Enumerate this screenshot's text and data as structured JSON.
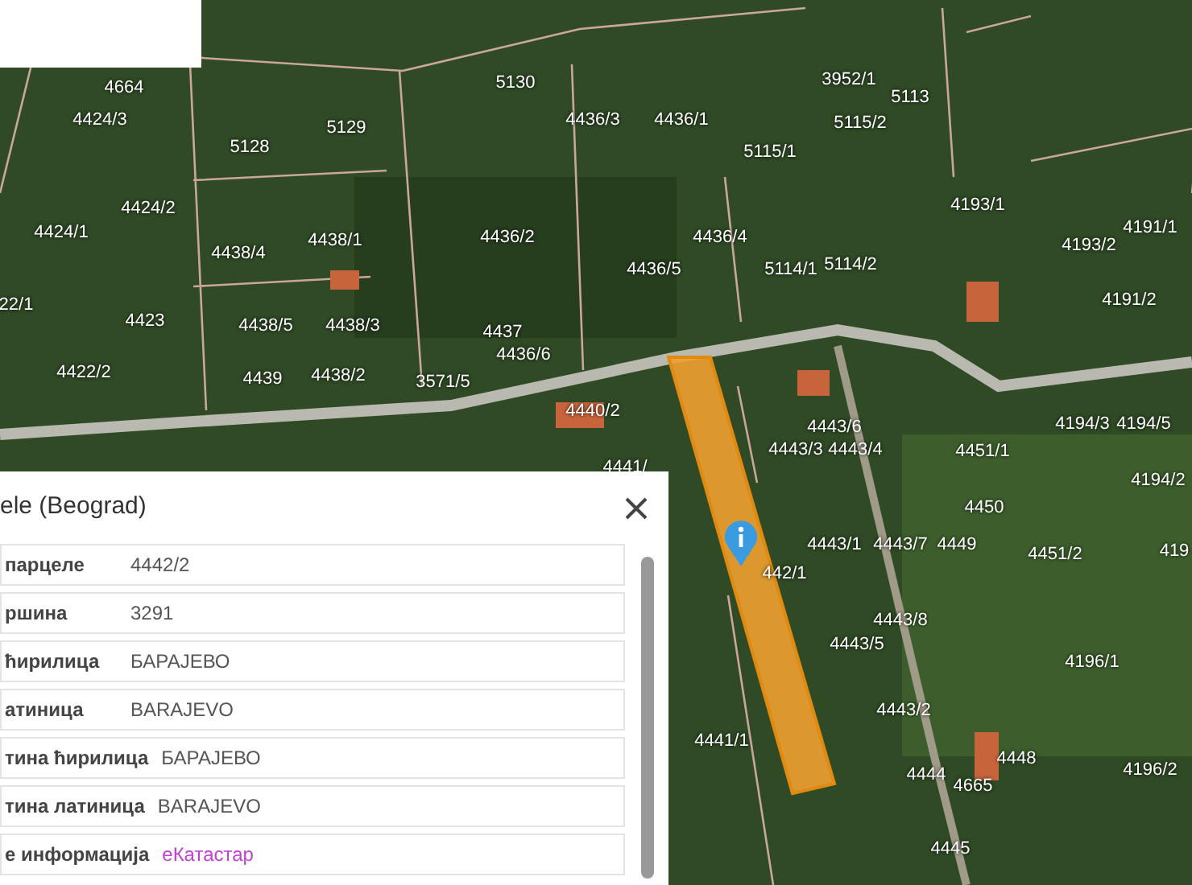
{
  "map": {
    "parcel_labels": [
      "4664",
      "4424/3",
      "5130",
      "5129",
      "5128",
      "4436/3",
      "4436/1",
      "3952/1",
      "5113",
      "5115/2",
      "5115/1",
      "4424/2",
      "4424/1",
      "4438/1",
      "4438/4",
      "4436/2",
      "4436/4",
      "4193/1",
      "4191/1",
      "4193/2",
      "4436/5",
      "5114/1",
      "5114/2",
      "22/1",
      "4423",
      "4438/5",
      "4438/3",
      "4437",
      "4191/2",
      "4436/6",
      "4422/2",
      "4439",
      "4438/2",
      "3571/5",
      "4440/2",
      "4443/6",
      "4194/3",
      "4194/5",
      "4443/3",
      "4443/4",
      "4451/1",
      "4441/",
      "4194/2",
      "4450",
      "4443/1",
      "4443/7",
      "4449",
      "4451/2",
      "442/1",
      "419",
      "4443/8",
      "4443/5",
      "4196/1",
      "4443/2",
      "4441/1",
      "4196/2",
      "4448",
      "4444",
      "4665",
      "4445"
    ]
  },
  "popup": {
    "title": "ele (Beograd)",
    "rows": [
      {
        "kind": "text",
        "label": "парцеле",
        "value": "4442/2"
      },
      {
        "kind": "text",
        "label": "ршина",
        "value": "3291"
      },
      {
        "kind": "text",
        "label": "ћирилица",
        "value": "БАРАЈЕВО"
      },
      {
        "kind": "text",
        "label": "атиница",
        "value": "BARAJEVO"
      },
      {
        "kind": "text",
        "label": "тина ћирилица",
        "value": "БАРАЈЕВО"
      },
      {
        "kind": "text",
        "label": "тина латиница",
        "value": "BARAJEVO"
      },
      {
        "kind": "link",
        "label": "е информација",
        "value": "еКатастар"
      }
    ]
  }
}
